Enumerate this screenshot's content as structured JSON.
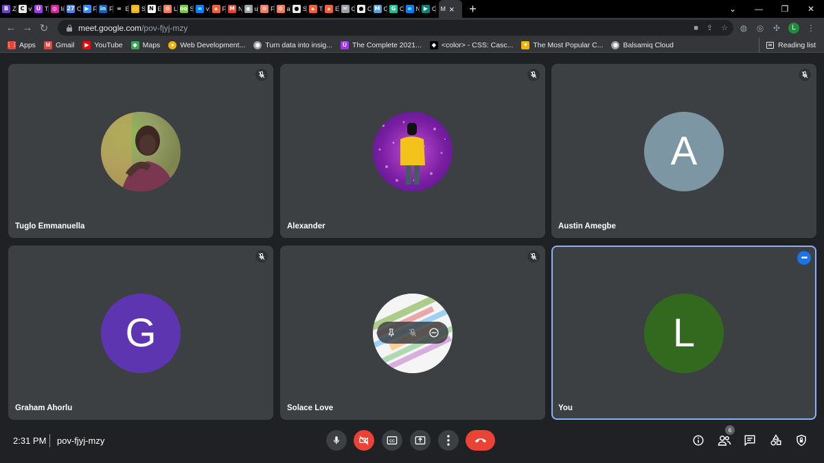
{
  "browser": {
    "tabs": [
      {
        "letter": "Z",
        "icon": "bizzabo-icon",
        "color": "#6f3fdc",
        "glyph": "B"
      },
      {
        "letter": "v",
        "icon": "c-icon",
        "color": "#e8eaed",
        "glyph": "C"
      },
      {
        "letter": "T",
        "icon": "udemy-icon",
        "color": "#a435f0",
        "glyph": "Ü"
      },
      {
        "letter": "Ii",
        "icon": "instagram-icon",
        "color": "#d6249f",
        "glyph": "◎"
      },
      {
        "letter": "C",
        "icon": "calendar-icon",
        "color": "#4285f4",
        "glyph": "27"
      },
      {
        "letter": "F",
        "icon": "zoom-icon",
        "color": "#2d8cff",
        "glyph": "▶"
      },
      {
        "letter": "F",
        "icon": "linkedin-icon",
        "color": "#0a66c2",
        "glyph": "in"
      },
      {
        "letter": "E",
        "icon": "infinity-icon",
        "color": "#000000",
        "glyph": "∞"
      },
      {
        "letter": "S",
        "icon": "slides-icon",
        "color": "#f4b400",
        "glyph": "▭"
      },
      {
        "letter": "E",
        "icon": "notion-icon",
        "color": "#ffffff",
        "glyph": "N"
      },
      {
        "letter": "L",
        "icon": "hubspot-icon",
        "color": "#ff7a59",
        "glyph": "⚙"
      },
      {
        "letter": "S",
        "icon": "loom-icon",
        "color": "#6fcf3c",
        "glyph": "oo"
      },
      {
        "letter": "v",
        "icon": "meta-icon",
        "color": "#0081fb",
        "glyph": "∞"
      },
      {
        "letter": "F",
        "icon": "hubspot-icon",
        "color": "#ff5c35",
        "glyph": "⚹"
      },
      {
        "letter": "N",
        "icon": "gmail-icon",
        "color": "#ea4335",
        "glyph": "M"
      },
      {
        "letter": "u",
        "icon": "globe-icon",
        "color": "#9aa0a6",
        "glyph": "◉"
      },
      {
        "letter": "F",
        "icon": "hubspot-icon",
        "color": "#ff7a59",
        "glyph": "⚙"
      },
      {
        "letter": "a",
        "icon": "hubspot-icon",
        "color": "#ff7a59",
        "glyph": "⚙"
      },
      {
        "letter": "S",
        "icon": "github-icon",
        "color": "#e8eaed",
        "glyph": "●"
      },
      {
        "letter": "T",
        "icon": "hubspot-icon",
        "color": "#ff5c35",
        "glyph": "⚹"
      },
      {
        "letter": "E",
        "icon": "hubspot-icon",
        "color": "#ff5c35",
        "glyph": "⚹"
      },
      {
        "letter": "C",
        "icon": "mail-icon",
        "color": "#9aa0a6",
        "glyph": "✉"
      },
      {
        "letter": "C",
        "icon": "github-icon",
        "color": "#e8eaed",
        "glyph": "●"
      },
      {
        "letter": "C",
        "icon": "m-icon",
        "color": "#4fa3e0",
        "glyph": "M"
      },
      {
        "letter": "C",
        "icon": "grammarly-icon",
        "color": "#15c39a",
        "glyph": "G"
      },
      {
        "letter": "N",
        "icon": "meta-icon",
        "color": "#0081fb",
        "glyph": "∞"
      },
      {
        "letter": "C",
        "icon": "meet-icon",
        "color": "#00897b",
        "glyph": "▶"
      }
    ],
    "active_tab": {
      "letter": "M",
      "close": "×"
    },
    "new_tab": "+",
    "window_controls": {
      "minimize": "—",
      "restore": "❐",
      "close": "✕",
      "dropdown": "⌄"
    },
    "url": {
      "host": "meet.google.com",
      "path": "/pov-fjyj-mzy"
    },
    "profile_letter": "L",
    "bookmarks": [
      {
        "label": "Apps",
        "icon": "apps-grid-icon",
        "color": "#ea4335",
        "glyph": "⋮⋮"
      },
      {
        "label": "Gmail",
        "icon": "gmail-icon",
        "color": "#ea4335",
        "glyph": "M"
      },
      {
        "label": "YouTube",
        "icon": "youtube-icon",
        "color": "#ff0000",
        "glyph": "▶"
      },
      {
        "label": "Maps",
        "icon": "maps-icon",
        "color": "#34a853",
        "glyph": "◆"
      },
      {
        "label": "Web Development...",
        "icon": "course-icon",
        "color": "#f4b400",
        "glyph": "●"
      },
      {
        "label": "Turn data into insig...",
        "icon": "globe-icon",
        "color": "#9aa0a6",
        "glyph": "◉"
      },
      {
        "label": "The Complete 2021...",
        "icon": "udemy-icon",
        "color": "#a435f0",
        "glyph": "Ü"
      },
      {
        "label": "<color> - CSS: Casc...",
        "icon": "mdn-icon",
        "color": "#000000",
        "glyph": "◆"
      },
      {
        "label": "The Most Popular C...",
        "icon": "bookmark-icon",
        "color": "#f4b400",
        "glyph": "▼"
      },
      {
        "label": "Balsamiq Cloud",
        "icon": "globe-icon",
        "color": "#9aa0a6",
        "glyph": "◉"
      }
    ],
    "reading_list": "Reading list"
  },
  "meeting": {
    "participants": [
      {
        "name": "Tuglo Emmanuella",
        "avatar": "photo",
        "muted": true
      },
      {
        "name": "Alexander",
        "avatar": "photo",
        "muted": true
      },
      {
        "name": "Austin Amegbe",
        "avatar_letter": "A",
        "avatar_color": "#7d96a3",
        "muted": true
      },
      {
        "name": "Graham Ahorlu",
        "avatar_letter": "G",
        "avatar_color": "#5e35b1",
        "muted": true
      },
      {
        "name": "Solace Love",
        "avatar": "photo",
        "muted": true
      },
      {
        "name": "You",
        "avatar_letter": "L",
        "avatar_color": "#33691e",
        "muted": false
      }
    ],
    "time": "2:31 PM",
    "meeting_code": "pov-fjyj-mzy",
    "participant_count": "6",
    "colors": {
      "hangup": "#ea4335",
      "camera_off": "#ea4335",
      "highlight": "#8ab4f8"
    }
  }
}
